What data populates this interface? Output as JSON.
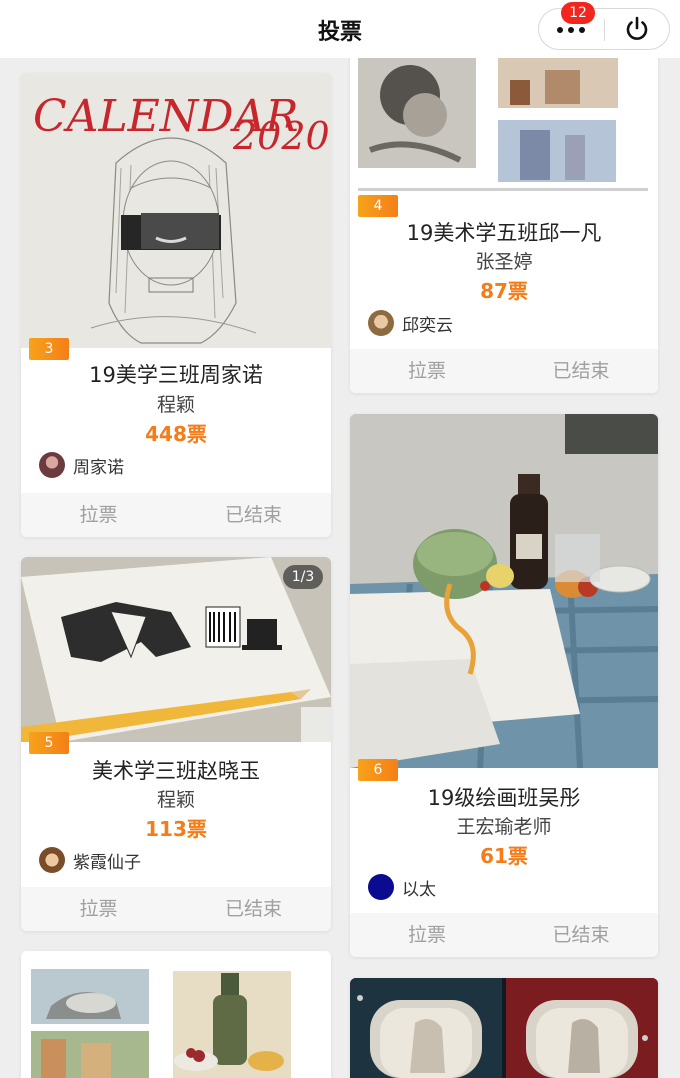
{
  "header": {
    "title": "投票",
    "badge_count": "12",
    "more_icon": "more-dots-icon",
    "power_icon": "power-icon"
  },
  "actions": {
    "vote_label": "拉票",
    "ended_label": "已结束"
  },
  "cards": [
    {
      "number": "3",
      "title": "19美学三班周家诺",
      "teacher": "程颖",
      "votes": "448票",
      "author": "周家诺",
      "artwork_text": [
        "CALENDAR",
        "2020"
      ]
    },
    {
      "number": "4",
      "title": "19美术学五班邱一凡",
      "teacher": "张圣婷",
      "votes": "87票",
      "author": "邱奕云"
    },
    {
      "number": "5",
      "title": "美术学三班赵晓玉",
      "teacher": "程颖",
      "votes": "113票",
      "author": "紫霞仙子",
      "page_indicator": "1/3"
    },
    {
      "number": "6",
      "title": "19级绘画班吴彤",
      "teacher": "王宏瑜老师",
      "votes": "61票",
      "author": "以太"
    }
  ],
  "colors": {
    "accent": "#f57c17",
    "badge": "#f2261e",
    "background": "#eeeeee"
  }
}
